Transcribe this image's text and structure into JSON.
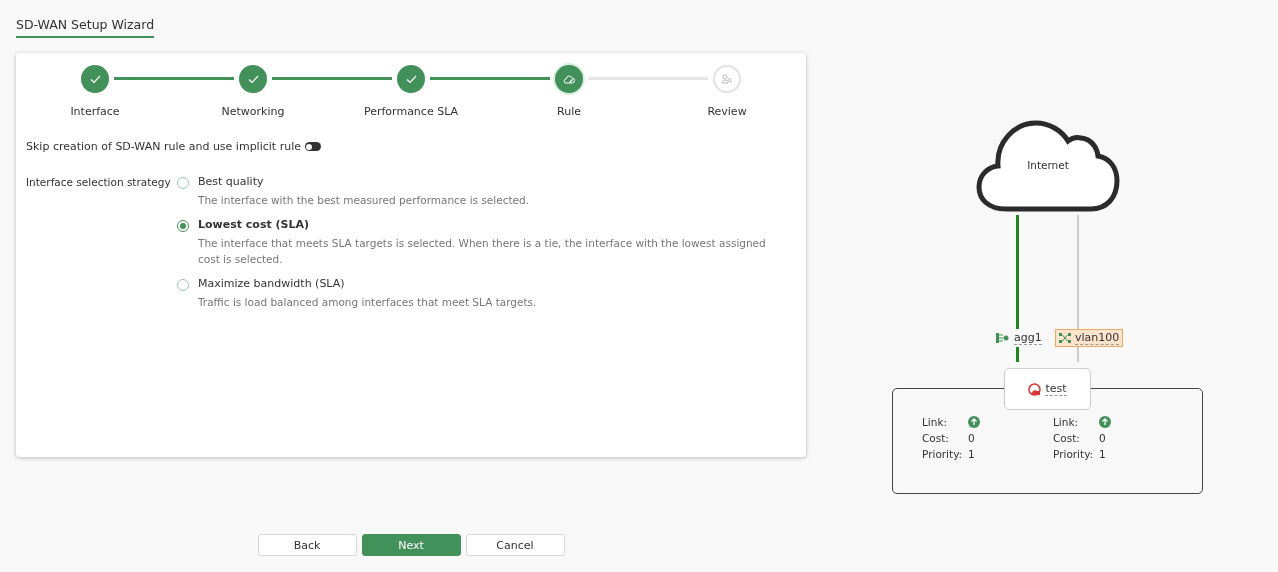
{
  "title": "SD-WAN Setup Wizard",
  "steps": [
    {
      "label": "Interface",
      "completed": true,
      "selected": false
    },
    {
      "label": "Networking",
      "completed": true,
      "selected": false
    },
    {
      "label": "Performance SLA",
      "completed": true,
      "selected": false
    },
    {
      "label": "Rule",
      "completed": false,
      "selected": true
    },
    {
      "label": "Review",
      "completed": false,
      "selected": false
    }
  ],
  "skip_rule": {
    "label": "Skip creation of SD-WAN rule and use implicit rule",
    "on": false
  },
  "strategy": {
    "label": "Interface selection strategy",
    "options": [
      {
        "label": "Best quality",
        "description": "The interface with the best measured performance is selected.",
        "selected": false
      },
      {
        "label": "Lowest cost (SLA)",
        "description": "The interface that meets SLA targets is selected. When there is a tie, the interface with the lowest assigned cost is selected.",
        "selected": true
      },
      {
        "label": "Maximize bandwidth (SLA)",
        "description": "Traffic is load balanced among interfaces that meet SLA targets.",
        "selected": false
      }
    ]
  },
  "diagram": {
    "cloud_label": "Internet",
    "zone": "test",
    "interfaces": [
      {
        "name": "agg1",
        "kind": "aggregate",
        "active": true,
        "highlighted": false
      },
      {
        "name": "vlan100",
        "kind": "vlan",
        "active": false,
        "highlighted": true
      }
    ],
    "members": [
      {
        "link_label": "Link:",
        "link_up": true,
        "cost_label": "Cost:",
        "cost": "0",
        "priority_label": "Priority:",
        "priority": "1"
      },
      {
        "link_label": "Link:",
        "link_up": true,
        "cost_label": "Cost:",
        "cost": "0",
        "priority_label": "Priority:",
        "priority": "1"
      }
    ]
  },
  "buttons": [
    {
      "label": "Back",
      "primary": false
    },
    {
      "label": "Next",
      "primary": true
    },
    {
      "label": "Cancel",
      "primary": false
    }
  ]
}
